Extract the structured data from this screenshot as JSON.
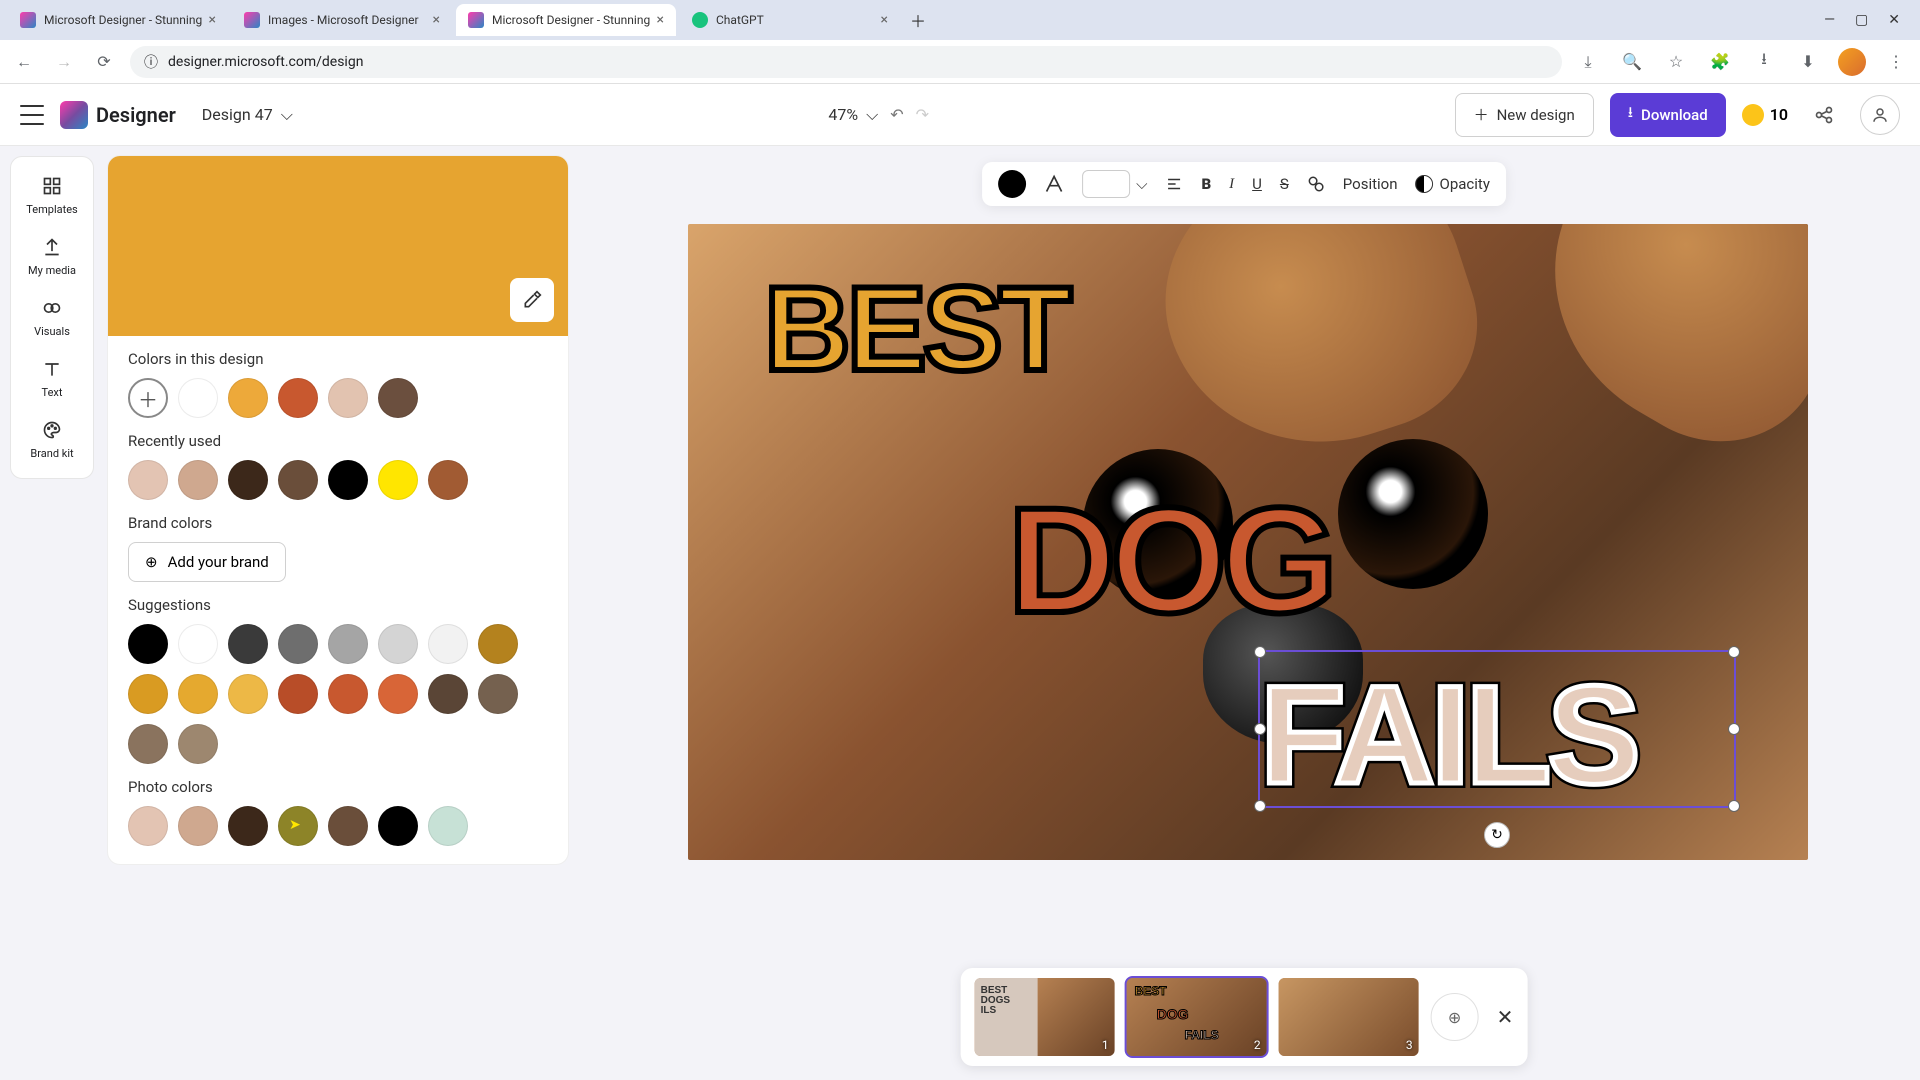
{
  "browser": {
    "tabs": [
      {
        "title": "Microsoft Designer - Stunning"
      },
      {
        "title": "Images - Microsoft Designer"
      },
      {
        "title": "Microsoft Designer - Stunning"
      },
      {
        "title": "ChatGPT"
      }
    ],
    "url": "designer.microsoft.com/design"
  },
  "header": {
    "app_name": "Designer",
    "design_name": "Design 47",
    "zoom": "47%",
    "new_design": "New design",
    "download": "Download",
    "credits": "10"
  },
  "side_rail": {
    "items": [
      "Templates",
      "My media",
      "Visuals",
      "Text",
      "Brand kit"
    ]
  },
  "color_panel": {
    "preview_color": "#e6a430",
    "sections": {
      "in_design": {
        "title": "Colors in this design",
        "colors": [
          "#ffffff",
          "#eda93a",
          "#c8582f",
          "#e2c3b0",
          "#6b4f3e"
        ]
      },
      "recently_used": {
        "title": "Recently used",
        "colors": [
          "#e3c4b3",
          "#cfa88f",
          "#3c281a",
          "#6a4e3a",
          "#000000",
          "#ffe600",
          "#a15b33"
        ]
      },
      "brand": {
        "title": "Brand colors",
        "add_brand": "Add your brand"
      },
      "suggestions": {
        "title": "Suggestions",
        "colors": [
          "#000000",
          "#ffffff",
          "#3a3a3a",
          "#6e6e6e",
          "#a5a5a5",
          "#d4d4d4",
          "#f2f2f2",
          "#b4821e",
          "#d99b22",
          "#e5a92f",
          "#edb846",
          "#b84d28",
          "#c8582f",
          "#d86537",
          "#5a4536",
          "#75614f",
          "#8a735e",
          "#9d876f"
        ]
      },
      "photo": {
        "title": "Photo colors",
        "colors": [
          "#e3c4b3",
          "#cfa88f",
          "#3c281a",
          "#8d8428",
          "#6a4e3a",
          "#000000",
          "#c7e1d6"
        ]
      }
    }
  },
  "toolbar": {
    "position": "Position",
    "opacity": "Opacity"
  },
  "canvas": {
    "words": [
      "BEST",
      "DOG",
      "FAILS"
    ]
  },
  "pages": {
    "thumbs": [
      {
        "num": "1"
      },
      {
        "num": "2"
      },
      {
        "num": "3"
      }
    ]
  }
}
